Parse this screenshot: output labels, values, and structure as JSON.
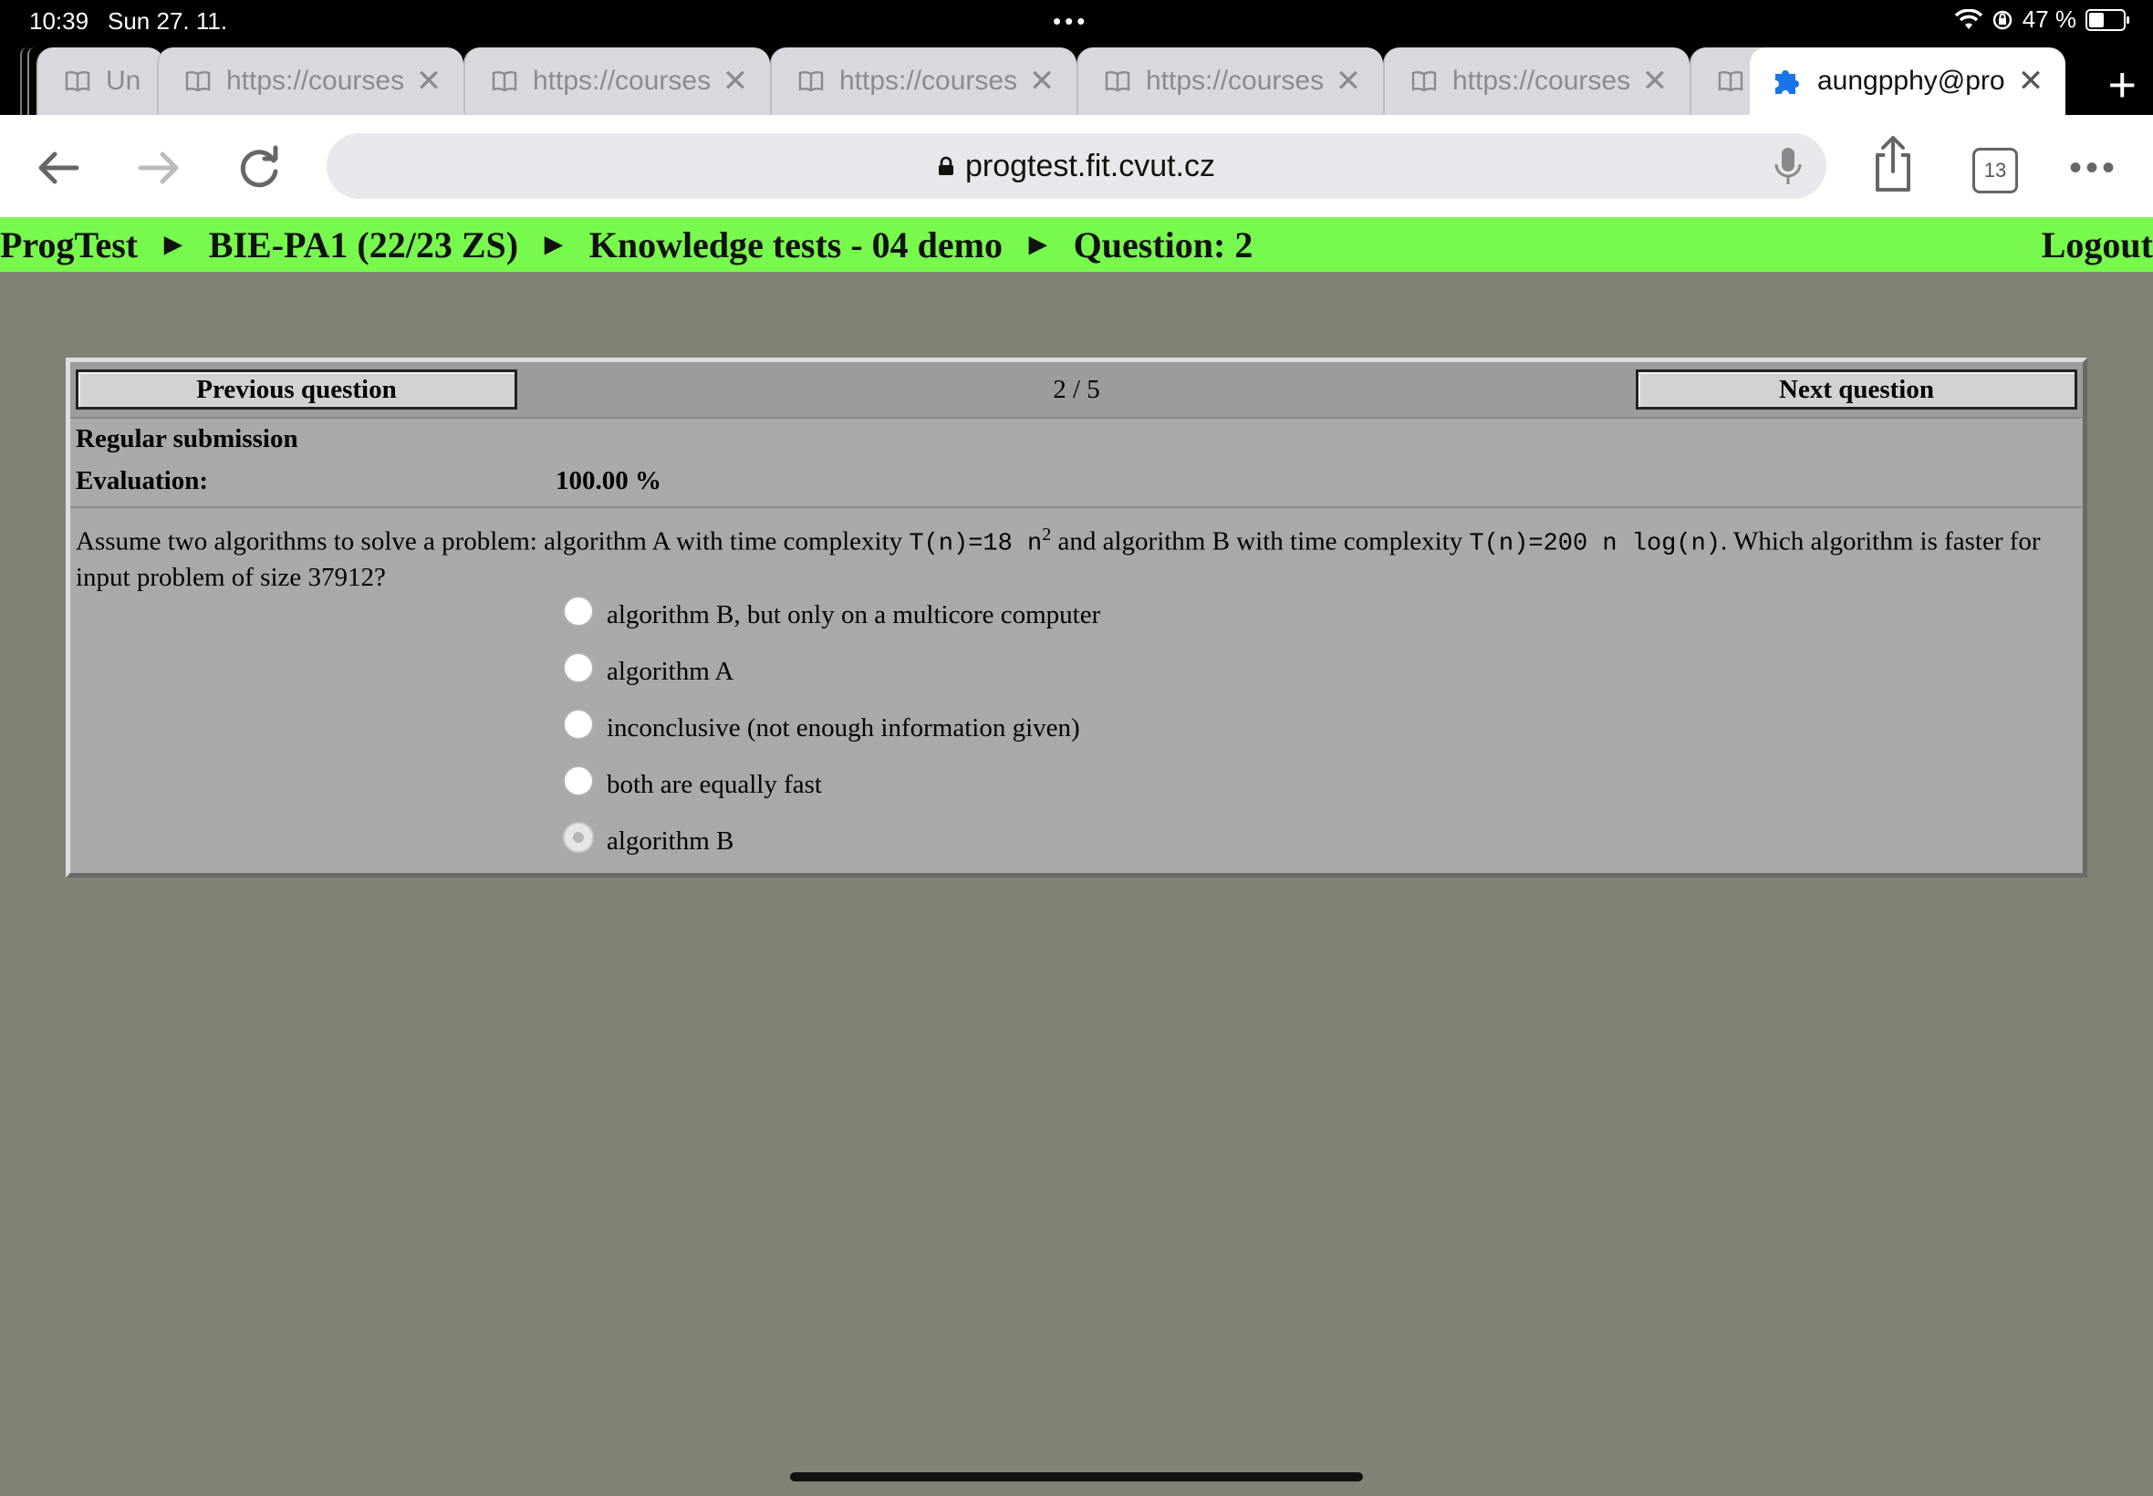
{
  "status_bar": {
    "time": "10:39",
    "date": "Sun 27. 11.",
    "battery_text": "47 %",
    "battery_level": 0.47
  },
  "browser": {
    "tabs": [
      {
        "title": "Un",
        "icon": "book-icon"
      },
      {
        "title": "https://courses",
        "icon": "book-icon"
      },
      {
        "title": "https://courses",
        "icon": "book-icon"
      },
      {
        "title": "https://courses",
        "icon": "book-icon"
      },
      {
        "title": "https://courses",
        "icon": "book-icon"
      },
      {
        "title": "https://courses",
        "icon": "book-icon"
      },
      {
        "title": "",
        "icon": "book-icon"
      },
      {
        "title": "aungpphy@pro",
        "icon": "puzzle-icon",
        "active": true
      }
    ],
    "address": "progtest.fit.cvut.cz",
    "tab_count": "13"
  },
  "progtest": {
    "breadcrumb": [
      "ProgTest",
      "BIE-PA1 (22/23 ZS)",
      "Knowledge tests - 04 demo",
      "Question: 2"
    ],
    "separator": "►",
    "logout": "Logout"
  },
  "panel": {
    "prev_label": "Previous question",
    "next_label": "Next question",
    "counter": "2 / 5",
    "submission_label": "Regular submission",
    "evaluation_label": "Evaluation:",
    "evaluation_value": "100.00 %",
    "question": {
      "part1": "Assume two algorithms to solve a problem: algorithm A with time complexity ",
      "formula_a": "T(n)=18 n",
      "formula_a_exp": "2",
      "part2": " and algorithm B with time complexity ",
      "formula_b": "T(n)=200 n log(n)",
      "part3": ". Which algorithm is faster for input problem of size 37912?"
    },
    "options": [
      {
        "label": "algorithm B, but only on a multicore computer",
        "selected": false
      },
      {
        "label": "algorithm A",
        "selected": false
      },
      {
        "label": "inconclusive (not enough information given)",
        "selected": false
      },
      {
        "label": "both are equally fast",
        "selected": false
      },
      {
        "label": "algorithm B",
        "selected": true
      }
    ]
  },
  "colors": {
    "page_bg": "#808373",
    "breadcrumb_bg": "#77f94d",
    "panel_bg": "#a9a9a9"
  }
}
